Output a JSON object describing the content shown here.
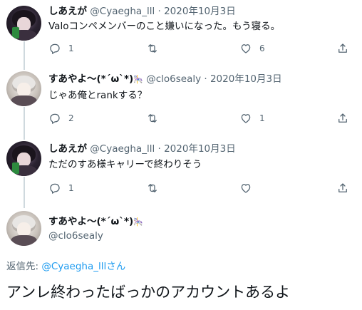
{
  "tweets": [
    {
      "name": "しあえが",
      "handle": "@Cyaegha_lll",
      "sep": "·",
      "date": "2020年10月3日",
      "text": "Valoコンペメンバーのこと嫌いになった。もう寝る。",
      "replies": "1",
      "retweets": "",
      "likes": "6",
      "avatar": "dark-hair-avatar"
    },
    {
      "name": "すあやよ〜(*´ω`*)",
      "name_emoji": "🎠",
      "handle": "@clo6sealy",
      "sep": "·",
      "date": "2020年10月3日",
      "text": "じゃあ俺とrankする？",
      "replies": "2",
      "retweets": "",
      "likes": "1",
      "avatar": "light-hair-avatar"
    },
    {
      "name": "しあえが",
      "handle": "@Cyaegha_lll",
      "sep": "·",
      "date": "2020年10月3日",
      "text": "ただのすあ様キャリーで終わりそう",
      "replies": "1",
      "retweets": "",
      "likes": "",
      "avatar": "dark-hair-avatar"
    }
  ],
  "focused": {
    "name": "すあやよ〜(*´ω`*)",
    "name_emoji": "🎠",
    "handle": "@clo6sealy",
    "reply_prefix": "返信先: ",
    "reply_mention": "@Cyaegha_lllさん",
    "text": "アンレ終わったばっかのアカウントあるよ"
  },
  "icons": [
    "reply-icon",
    "retweet-icon",
    "like-icon",
    "share-icon"
  ],
  "colors": {
    "text": "#0f1419",
    "muted": "#536471",
    "link": "#1d9bf0",
    "thread": "#cfd9de"
  }
}
